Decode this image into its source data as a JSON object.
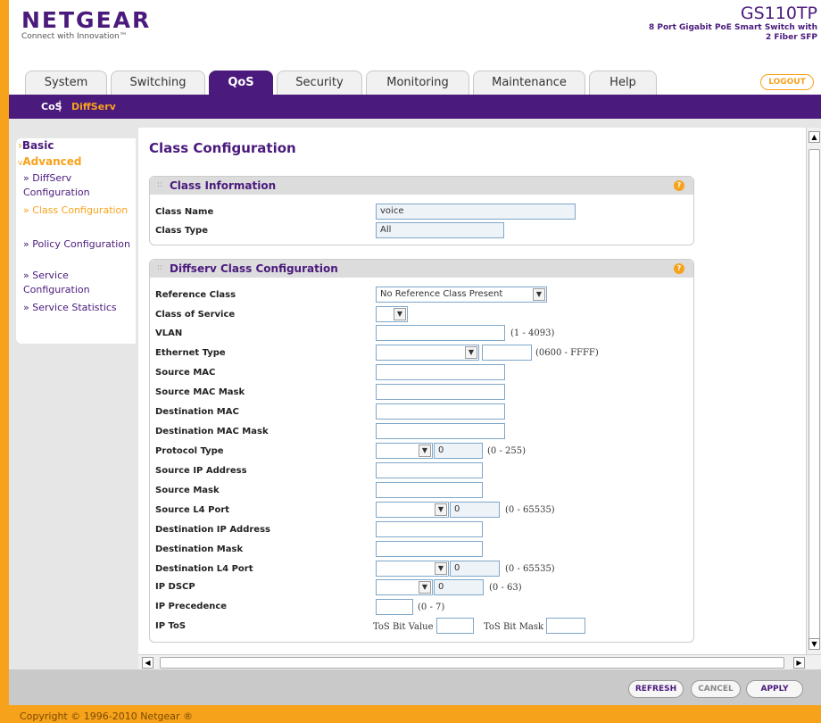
{
  "brand": {
    "logo_text": "NETGEAR",
    "tagline": "Connect with Innovation™",
    "model": "GS110TP",
    "description": "8 Port Gigabit PoE Smart Switch with 2 Fiber SFP"
  },
  "tabs": [
    {
      "label": "System",
      "active": false
    },
    {
      "label": "Switching",
      "active": false
    },
    {
      "label": "QoS",
      "active": true
    },
    {
      "label": "Security",
      "active": false
    },
    {
      "label": "Monitoring",
      "active": false
    },
    {
      "label": "Maintenance",
      "active": false
    },
    {
      "label": "Help",
      "active": false
    }
  ],
  "logout_label": "LOGOUT",
  "subnav": {
    "cos": "CoS",
    "separator": "|",
    "diffserv": "DiffServ"
  },
  "sidebar": {
    "basic": "Basic",
    "advanced": "Advanced",
    "items": [
      {
        "label": "» DiffServ Configuration"
      },
      {
        "label": "» Class Configuration",
        "current": true
      },
      {
        "label": "» Policy Configuration"
      },
      {
        "label": "» Service Configuration"
      },
      {
        "label": "» Service Statistics"
      }
    ]
  },
  "main": {
    "title": "Class Configuration",
    "class_info": {
      "header": "Class Information",
      "help": "?",
      "name_label": "Class Name",
      "name_value": "voice",
      "type_label": "Class Type",
      "type_value": "All"
    },
    "diffserv": {
      "header": "Diffserv Class Configuration",
      "help": "?",
      "reference_class_label": "Reference Class",
      "reference_class_value": "No Reference Class Present",
      "cos_label": "Class of Service",
      "vlan_label": "VLAN",
      "vlan_range": "(1 - 4093)",
      "ethertype_label": "Ethernet Type",
      "ethertype_range": "(0600 - FFFF)",
      "src_mac_label": "Source MAC",
      "src_mac_mask_label": "Source MAC Mask",
      "dst_mac_label": "Destination MAC",
      "dst_mac_mask_label": "Destination MAC Mask",
      "protocol_label": "Protocol Type",
      "protocol_value": "0",
      "protocol_range": "(0 - 255)",
      "src_ip_label": "Source IP Address",
      "src_mask_label": "Source Mask",
      "src_l4_label": "Source L4 Port",
      "src_l4_value": "0",
      "src_l4_range": "(0 - 65535)",
      "dst_ip_label": "Destination IP Address",
      "dst_mask_label": "Destination Mask",
      "dst_l4_label": "Destination L4 Port",
      "dst_l4_value": "0",
      "dst_l4_range": "(0 - 65535)",
      "dscp_label": "IP DSCP",
      "dscp_value": "0",
      "dscp_range": "(0 - 63)",
      "prec_label": "IP Precedence",
      "prec_range": "(0 - 7)",
      "tos_label": "IP ToS",
      "tos_bit_value_label": "ToS Bit Value",
      "tos_bit_mask_label": "ToS Bit Mask"
    }
  },
  "actions": {
    "refresh": "REFRESH",
    "cancel": "CANCEL",
    "apply": "APPLY"
  },
  "footer": "Copyright © 1996-2010 Netgear ®",
  "colors": {
    "brand_purple": "#4a1a7c",
    "brand_orange": "#f7a21b"
  }
}
